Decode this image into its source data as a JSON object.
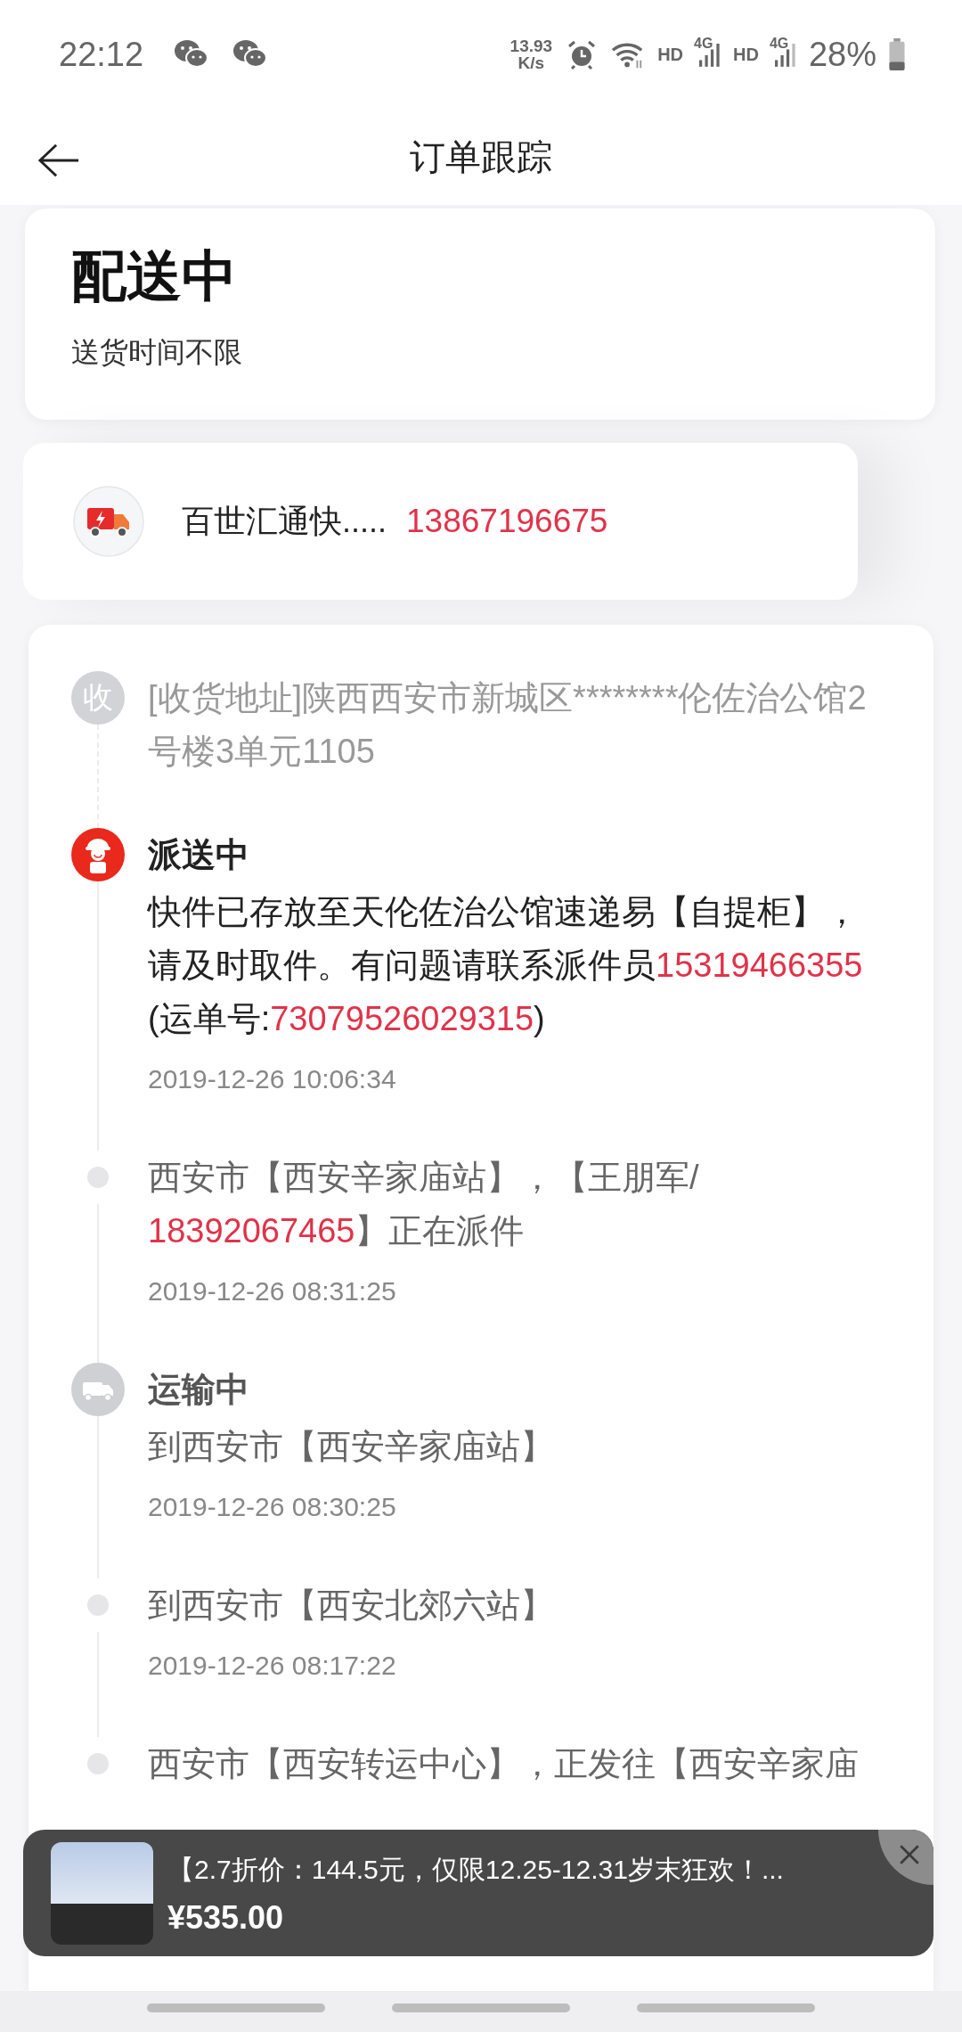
{
  "status_bar": {
    "time": "22:12",
    "speed_value": "13.93",
    "speed_unit": "K/s",
    "signals": [
      {
        "label": "HD",
        "network": "4G"
      },
      {
        "label": "HD",
        "network": "4G"
      }
    ],
    "battery": "28%"
  },
  "header": {
    "title": "订单跟踪"
  },
  "status_card": {
    "status": "配送中",
    "note": "送货时间不限"
  },
  "courier": {
    "name": "百世汇通快.....",
    "phone": "13867196675"
  },
  "timeline": [
    {
      "kind": "address",
      "icon_text": "收",
      "parts": [
        {
          "kind": "text",
          "text": "[收货地址]陕西西安市新城区********伦佐治公馆2号楼3单元1105"
        }
      ]
    },
    {
      "kind": "dispatch",
      "title": "派送中",
      "active": true,
      "parts": [
        {
          "kind": "text",
          "text": "快件已存放至天伦佐治公馆速递易【自提柜】，请及时取件。有问题请联系派件员"
        },
        {
          "kind": "phone",
          "text": "15319466355"
        },
        {
          "kind": "text",
          "text": "(运单号:"
        },
        {
          "kind": "phone",
          "text": "73079526029315"
        },
        {
          "kind": "text",
          "text": ")"
        }
      ],
      "time": "2019-12-26 10:06:34"
    },
    {
      "kind": "event",
      "active": false,
      "parts": [
        {
          "kind": "text",
          "text": "西安市【西安辛家庙站】，【王朋军/"
        },
        {
          "kind": "phone",
          "text": "18392067465"
        },
        {
          "kind": "text",
          "text": "】正在派件"
        }
      ],
      "time": "2019-12-26 08:31:25"
    },
    {
      "kind": "transit",
      "title": "运输中",
      "active": false,
      "parts": [
        {
          "kind": "text",
          "text": "到西安市【西安辛家庙站】"
        }
      ],
      "time": "2019-12-26 08:30:25"
    },
    {
      "kind": "event",
      "active": false,
      "parts": [
        {
          "kind": "text",
          "text": "到西安市【西安北郊六站】"
        }
      ],
      "time": "2019-12-26 08:17:22"
    },
    {
      "kind": "event",
      "active": false,
      "parts": [
        {
          "kind": "text",
          "text": "西安市【西安转运中心】，正发往【西安辛家庙"
        }
      ]
    }
  ],
  "promo": {
    "title": "【2.7折价：144.5元，仅限12.25-12.31岁末狂欢！...",
    "price": "¥535.00"
  }
}
